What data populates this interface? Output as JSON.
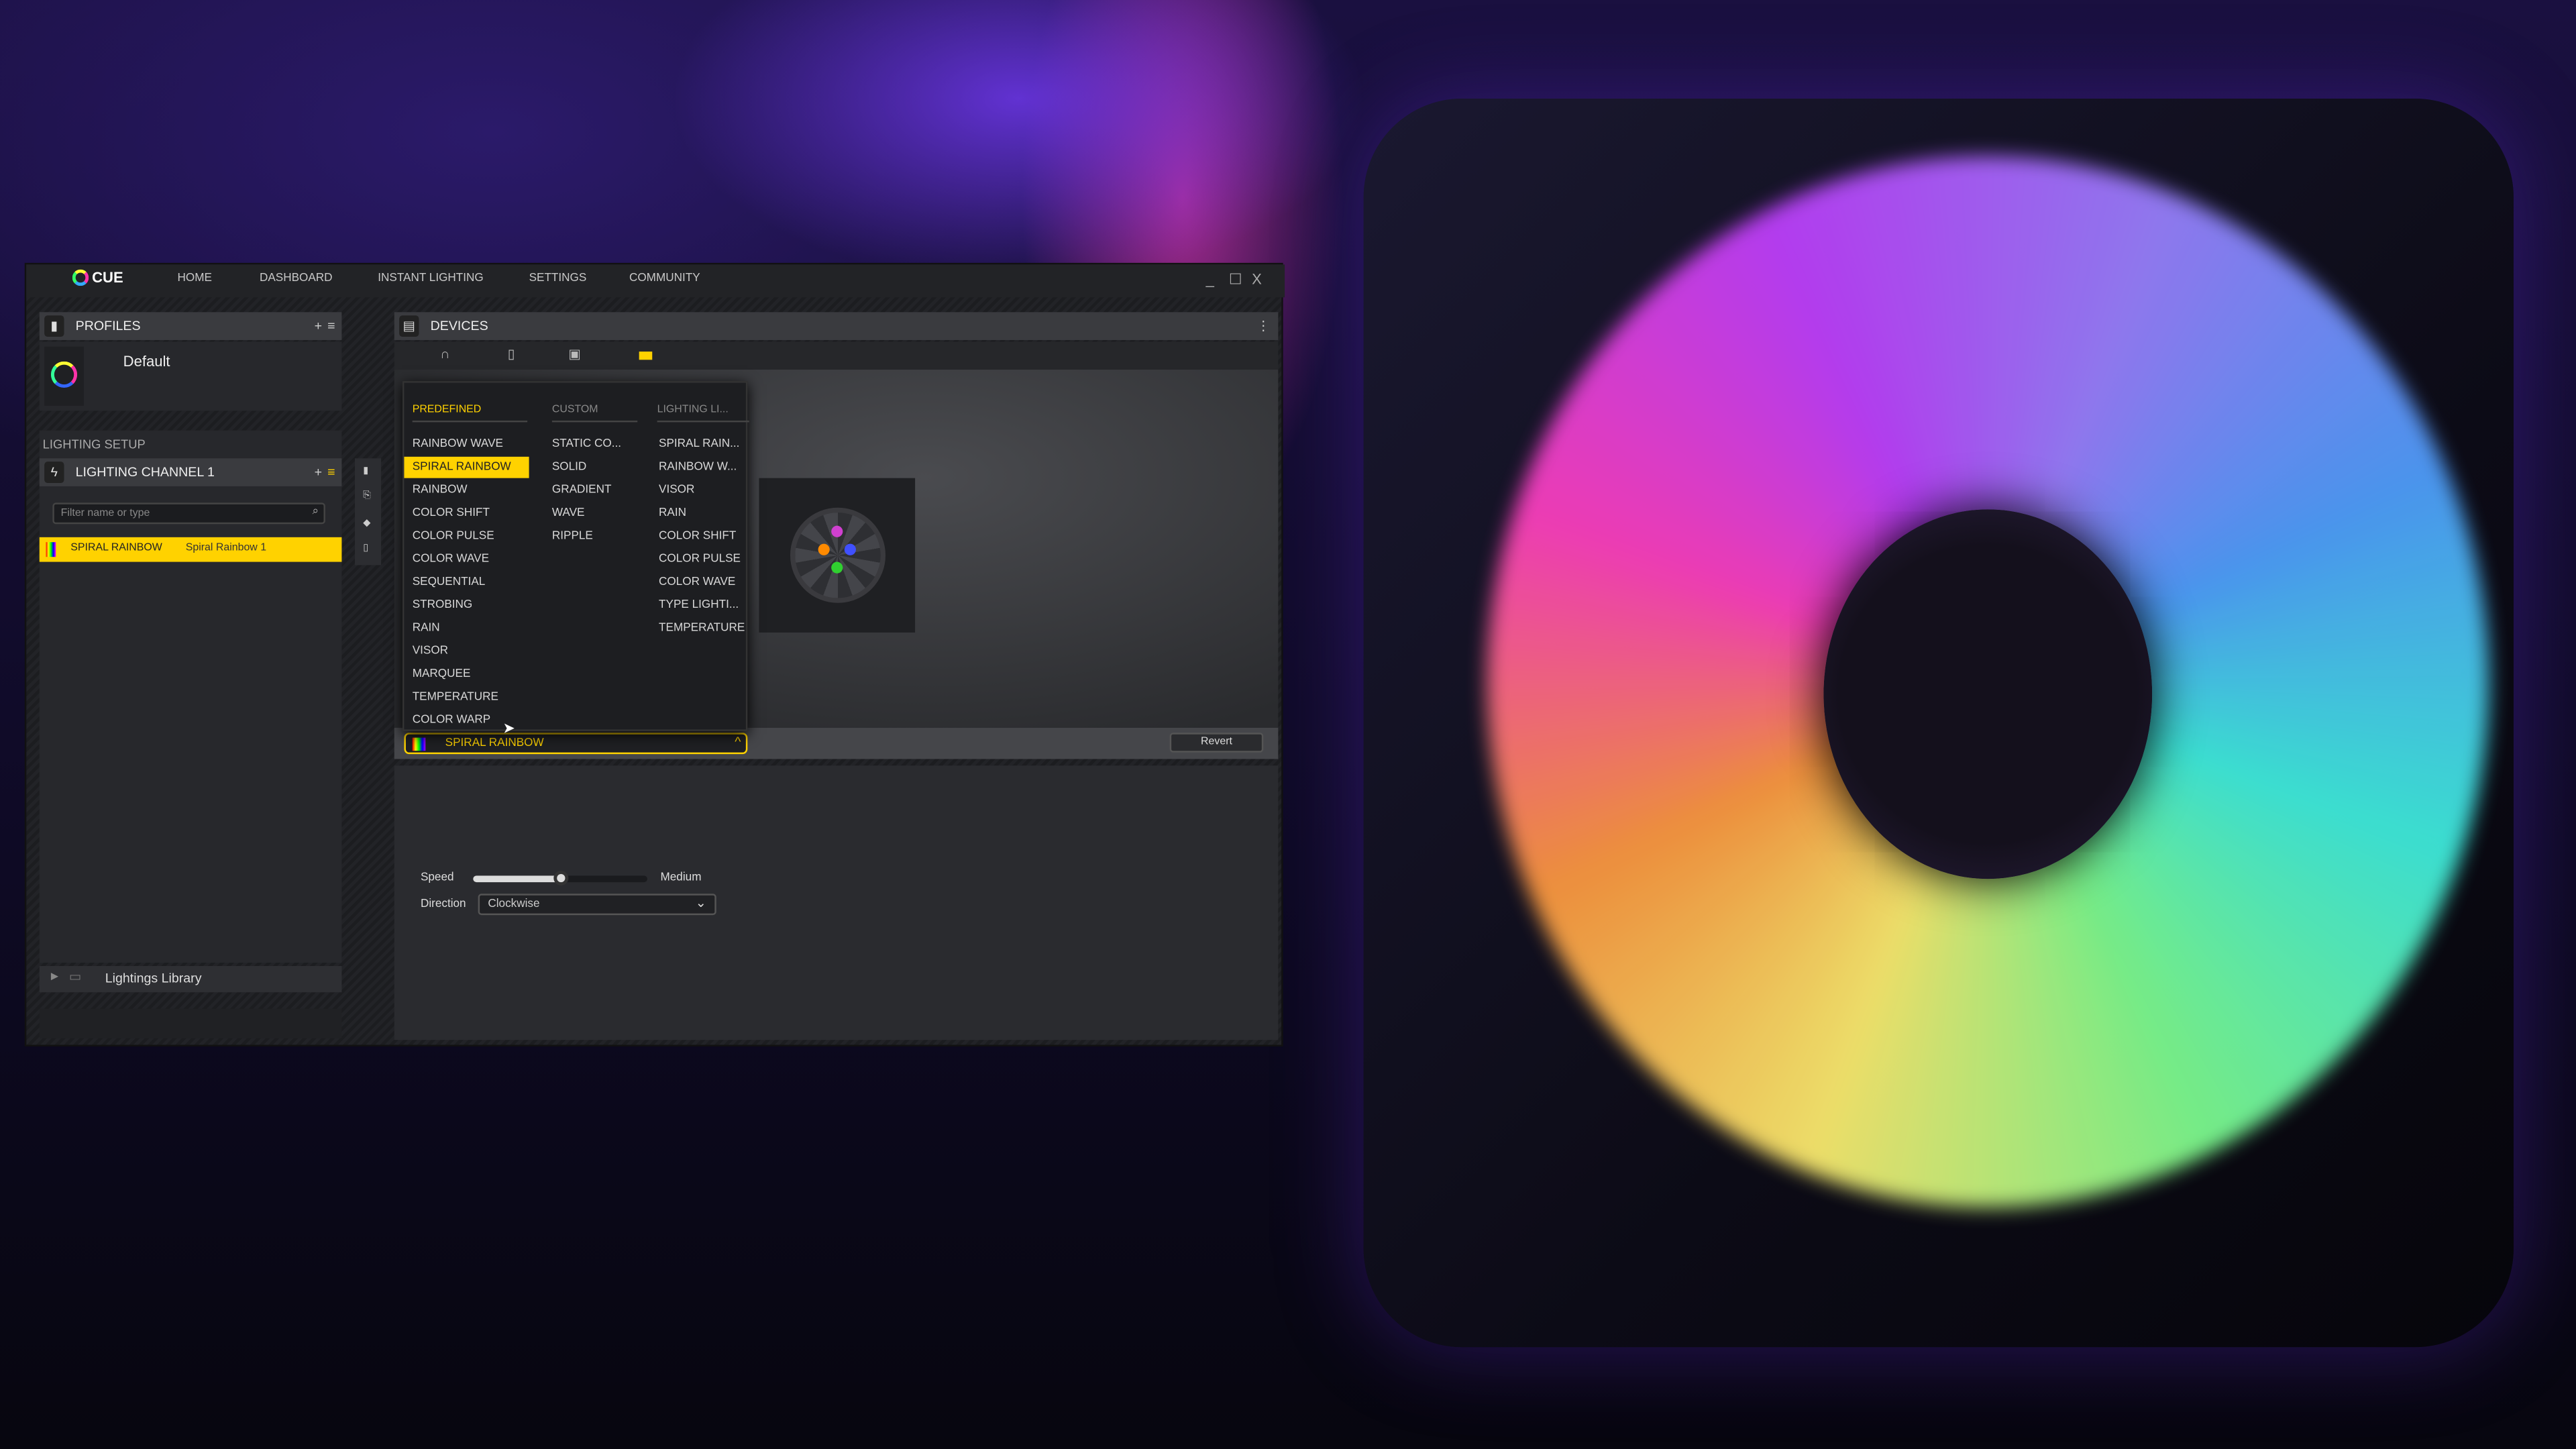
{
  "app": {
    "logo_text": "CUE",
    "nav": [
      "HOME",
      "DASHBOARD",
      "INSTANT LIGHTING",
      "SETTINGS",
      "COMMUNITY"
    ],
    "window_controls": [
      "_",
      "☐",
      "X"
    ]
  },
  "profiles": {
    "header": "PROFILES",
    "add": "+",
    "menu": "≡",
    "default_name": "Default"
  },
  "lighting_setup": {
    "label": "LIGHTING SETUP",
    "channel_header": "LIGHTING CHANNEL 1",
    "filter_placeholder": "Filter name or type",
    "effect_type": "SPIRAL RAINBOW",
    "effect_name": "Spiral Rainbow 1"
  },
  "library": {
    "label": "Lightings Library"
  },
  "devices": {
    "header": "DEVICES",
    "tabs": [
      "headset-icon",
      "mouse-icon",
      "fan-controller-icon",
      "lighting-node-icon"
    ],
    "active_tab": 3
  },
  "effect_menu": {
    "tabs": [
      "PREDEFINED",
      "CUSTOM",
      "LIGHTING LI..."
    ],
    "predefined": [
      "RAINBOW WAVE",
      "SPIRAL RAINBOW",
      "RAINBOW",
      "COLOR SHIFT",
      "COLOR PULSE",
      "COLOR WAVE",
      "SEQUENTIAL",
      "STROBING",
      "RAIN",
      "VISOR",
      "MARQUEE",
      "TEMPERATURE",
      "COLOR WARP"
    ],
    "custom": [
      "STATIC CO...",
      "SOLID",
      "GRADIENT",
      "WAVE",
      "RIPPLE"
    ],
    "library": [
      "SPIRAL RAIN...",
      "RAINBOW W...",
      "VISOR",
      "RAIN",
      "COLOR SHIFT",
      "COLOR PULSE",
      "COLOR WAVE",
      "TYPE LIGHTI...",
      "TEMPERATURE"
    ],
    "selected": "SPIRAL RAINBOW"
  },
  "revert": "Revert",
  "settings": {
    "speed_label": "Speed",
    "speed_value": "Medium",
    "speed_fraction": 0.5,
    "direction_label": "Direction",
    "direction_value": "Clockwise"
  },
  "colors": {
    "accent": "#ffd200",
    "panel": "#27282c",
    "header": "#3a3b3f"
  }
}
